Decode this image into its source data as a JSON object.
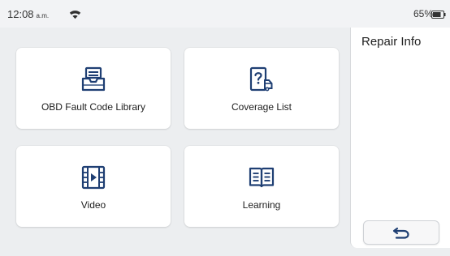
{
  "status_bar": {
    "time": "12:08",
    "ampm": "a.m.",
    "battery_percent": "65%",
    "icons": [
      "wifi-icon",
      "battery-icon"
    ]
  },
  "tiles": [
    {
      "label": "OBD Fault Code Library",
      "icon": "inbox-tray-icon"
    },
    {
      "label": "Coverage List",
      "icon": "vehicle-question-icon"
    },
    {
      "label": "Video",
      "icon": "film-play-icon"
    },
    {
      "label": "Learning",
      "icon": "open-book-icon"
    }
  ],
  "side_panel": {
    "title": "Repair Info",
    "back_icon": "return-arrow-icon"
  },
  "colors": {
    "accent": "#1f3f73",
    "background": "#eceef0",
    "panel": "#ffffff"
  }
}
